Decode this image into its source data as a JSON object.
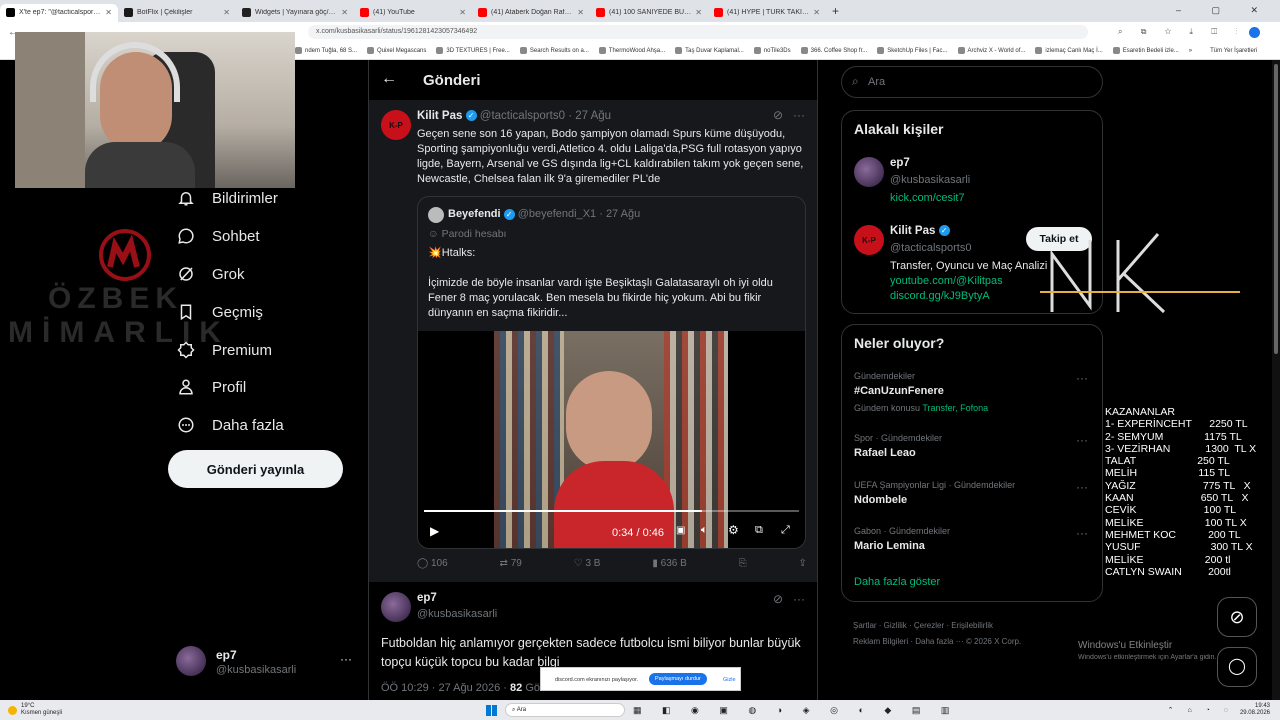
{
  "browser": {
    "tabs": [
      {
        "label": "X'te ep7: \"@tacticalsports0 Futbol",
        "color": "#000000",
        "active": true
      },
      {
        "label": "BotFlix | Çekilişler",
        "color": "#1a1a1a",
        "active": false
      },
      {
        "label": "Widgets | Yayınara göç/endirmeler",
        "color": "#222222",
        "active": false
      },
      {
        "label": "(41) YouTube",
        "color": "#ff0000",
        "active": false
      },
      {
        "label": "(41) Ataberk Doğan Rafael Leao",
        "color": "#ff0000",
        "active": false
      },
      {
        "label": "(41) 100 SANİYEDE BU KİM? - 5",
        "color": "#ff0000",
        "active": false
      },
      {
        "label": "(41) HYPE | TÜRK TAKIMLARININ",
        "color": "#ff0000",
        "active": false
      }
    ],
    "new_tab": "+",
    "address": "x.com/kusbasikasarli/status/1961281423057346492",
    "bookmarks": [
      "ndem Tuğla, 68 S...",
      "Quixel Megascans",
      "3D TEXTURES | Free...",
      "Search Results on a...",
      "ThermoWood Ahşa...",
      "Taş Duvar Kaplamal...",
      "noTile3Ds",
      "366. Coffee Shop fr...",
      "SketchUp Files | Fac...",
      "Archviz X - World of...",
      "izlemaç Canlı Maç İ...",
      "Esaretin Bedeli izle..."
    ],
    "bookmarks_more": "»",
    "all_bookmarks": "Tüm Yer İşaretleri"
  },
  "nav": {
    "items": [
      {
        "label": "Bildirimler",
        "icon": "bell-icon"
      },
      {
        "label": "Sohbet",
        "icon": "chat-icon"
      },
      {
        "label": "Grok",
        "icon": "grok-icon"
      },
      {
        "label": "Geçmiş",
        "icon": "bookmark-icon"
      },
      {
        "label": "Premium",
        "icon": "premium-icon"
      },
      {
        "label": "Profil",
        "icon": "person-icon"
      },
      {
        "label": "Daha fazla",
        "icon": "more-circle-icon"
      }
    ],
    "post_button": "Gönderi yayınla",
    "account_name": "ep7",
    "account_handle": "@kusbasikasarli",
    "account_more": "···"
  },
  "watermark": {
    "line1": "ÖZBEK",
    "line2": "MİMARLIK"
  },
  "header": {
    "back": "←",
    "title": "Gönderi"
  },
  "quoted_post": {
    "author": "Kilit Pas",
    "handle": "@tacticalsports0",
    "time": "· 27 Ağu",
    "text": "Geçen sene son 16 yapan, Bodo şampiyon olamadı Spurs küme düşüyodu, Sporting şampiyonluğu verdi,Atletico 4. oldu Laliga'da,PSG full rotasyon yapıyo ligde, Bayern, Arsenal ve GS dışında lig+CL kaldırabilen takım yok geçen sene, Newcastle, Chelsea falan ilk 9'a giremediler PL'de",
    "inner": {
      "author": "Beyefendi",
      "handle": "@beyefendi_X1",
      "time": "· 27 Ağu",
      "parody": "Parodi hesabı",
      "line1": "💥Htalks:",
      "text": "İçimizde de böyle insanlar vardı işte Beşiktaşlı Galatasaraylı oh iyi oldu Fener 8 maç yorulacak. Ben mesela bu fikirde hiç yokum. Abi bu fikir dünyanın en saçma fikiridir...",
      "video_time": "0:34 / 0:46",
      "progress": 0.74
    },
    "stats": {
      "replies": "106",
      "reposts": "79",
      "likes": "3 B",
      "views": "636 B"
    }
  },
  "main_post": {
    "author": "ep7",
    "handle": "@kusbasikasarli",
    "text": "Futboldan hiç anlamıyor gerçekten sadece futbolcu ismi biliyor bunlar büyük topçu küçük topcu bu kadar bilgi",
    "meta": "ÖÖ 10:29 · 27 Ağu 2026 ·",
    "views": "82",
    "views_label": "Gör"
  },
  "search": {
    "placeholder": "Ara"
  },
  "related": {
    "title": "Alakalı kişiler",
    "people": [
      {
        "name": "ep7",
        "handle": "@kusbasikasarli",
        "bio": "kick.com/cesit7"
      },
      {
        "name": "Kilit Pas",
        "handle": "@tacticalsports0",
        "bio": "Transfer, Oyuncu ve Maç Analizi",
        "link1": "youtube.com/@Kilitpas",
        "link2": "discord.gg/kJ9BytyA",
        "follow": "Takip et"
      }
    ]
  },
  "trends": {
    "title": "Neler oluyor?",
    "items": [
      {
        "cat": "Gündemdekiler",
        "title": "#CanUzunFenere",
        "extra_label": "Gündem konusu",
        "extra": "Transfer, Fofona"
      },
      {
        "cat": "Spor · Gündemdekiler",
        "title": "Rafael Leao"
      },
      {
        "cat": "UEFA Şampiyonlar Ligi · Gündemdekiler",
        "title": "Ndombele"
      },
      {
        "cat": "Gabon · Gündemdekiler",
        "title": "Mario Lemina"
      }
    ],
    "show_more": "Daha fazla göster"
  },
  "footer_links": [
    "Şartlar",
    "Gizlilik",
    "Çerezler",
    "Erişilebilirlik",
    "Reklam Bilgileri",
    "Daha fazla ···",
    "© 2026 X Corp."
  ],
  "windows_activate": {
    "title": "Windows'u Etkinleştir",
    "sub": "Windows'u etkinleştirmek için Ayarlar'a gidin."
  },
  "screen_share": {
    "text": "discord.com ekranınızı paylaşıyor.",
    "stop": "Paylaşmayı durdur",
    "hide": "Gizle"
  },
  "winners": [
    "KAZANANLAR",
    "1- EXPERİNCEHT      2250 TL",
    "2- SEMYUM              1175 TL",
    "3- VEZİRHAN            1300  TL X",
    "TALAT                     250 TL",
    "MELİH                     115 TL",
    "YAĞIZ                       775 TL   X",
    "KAAN                       650 TL   X",
    "CEVİK                       100 TL",
    "MELİKE                     100 TL X",
    "MEHMET KOC           200 TL",
    "YUSUF                        300 TL X",
    "MELİKE                     200 tl",
    "CATLYN SWAIN         200tl"
  ],
  "taskbar": {
    "weather": "19°C",
    "weather_sub": "Kısmen güneşli",
    "search": "Ara",
    "time": "19:43",
    "date": "29.08.2026"
  },
  "colors": {
    "accent": "#1d9bf0",
    "bg": "#000000",
    "border": "#2f3336",
    "muted": "#71767b",
    "link": "#1d9bf0",
    "green_link": "#00ba7c"
  }
}
